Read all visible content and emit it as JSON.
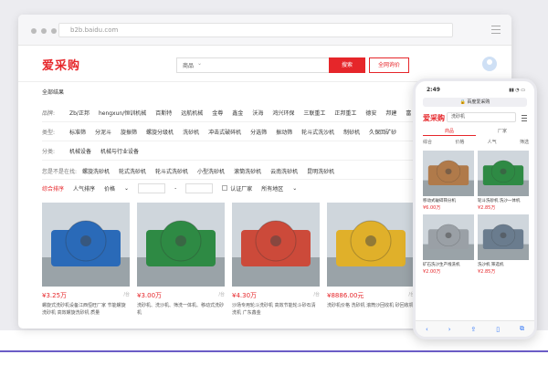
{
  "browser": {
    "url": "b2b.baidu.com"
  },
  "header": {
    "logo": "爱采购",
    "search_select": "商品",
    "search_button": "搜索",
    "release_button": "全网询价"
  },
  "results": {
    "all_label": "全部结果"
  },
  "filters": [
    {
      "label": "品牌:",
      "options": [
        "Zb/正邦",
        "hengxun/恒训机械",
        "百斯特",
        "远航机械",
        "金尊",
        "鑫金",
        "沃海",
        "鸿兴环保",
        "三联重工",
        "正邦重工",
        "德安",
        "邦建",
        "富"
      ]
    },
    {
      "label": "类型:",
      "options": [
        "标准筛",
        "分泥斗",
        "旋振筛",
        "螺旋分级机",
        "洗砂机",
        "冲击式破碎机",
        "分选筛",
        "振动筛",
        "轮斗式洗沙机",
        "制砂机",
        "久保回矿砂"
      ]
    },
    {
      "label": "分类:",
      "options": [
        "机械设备",
        "机械与行业设备"
      ]
    },
    {
      "label": "您是不是在找:",
      "options": [
        "螺旋洗砂机",
        "轮式洗砂机",
        "轮斗式洗砂机",
        "小型洗砂机",
        "滚筒洗砂机",
        "云南洗砂机",
        "昆明洗砂机"
      ]
    }
  ],
  "sort": {
    "items": [
      "综合排序",
      "人气排序",
      "价格"
    ],
    "price_sep": "-",
    "verified": "认证厂家",
    "region": "所有地区"
  },
  "products": [
    {
      "price": "¥3.25万",
      "unit": "/台",
      "desc": "螺旋式洗砂机设备江西恒旺厂家 节能螺旋洗砂机 高效螺旋洗砂机 质量",
      "color": "#2a6ab8"
    },
    {
      "price": "¥3.00万",
      "unit": "/台",
      "desc": "洗砂机、洗沙机、筛洗一体机、移动式洗砂机",
      "color": "#2e8a44"
    },
    {
      "price": "¥4.30万",
      "unit": "/台",
      "desc": "沙场专用轮斗洗砂机 高效节能轮斗砂石清洗机 广东鑫金",
      "color": "#cc4a3a"
    },
    {
      "price": "¥8886.00元",
      "unit": "/台",
      "desc": "洗砂机价格 洗砂机 滚筒沙回收机 砂回收机",
      "color": "#e0b02a"
    }
  ],
  "phone": {
    "time": "2:49",
    "url": "百度爱采购",
    "logo": "爱采购",
    "search": "洗砂机",
    "tabs": [
      "商品",
      "厂家"
    ],
    "sort": [
      "综合",
      "价格",
      "人气",
      "筛选"
    ],
    "items": [
      {
        "title": "移动式破碎筛分机",
        "price": "¥6.00万",
        "color": "#b07a4a"
      },
      {
        "title": "轮斗洗砂机 洗沙一体机",
        "price": "¥2.85万",
        "color": "#2e8a44"
      },
      {
        "title": "矿石洗沙生产线洗机",
        "price": "¥2.00万",
        "color": "#9aa0a6"
      },
      {
        "title": "洗沙机 筛选机",
        "price": "¥2.85万",
        "color": "#6a7c8e"
      }
    ]
  }
}
